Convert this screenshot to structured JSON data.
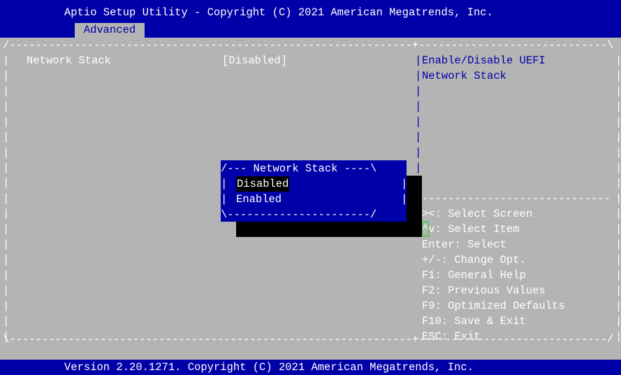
{
  "header": {
    "title": "Aptio Setup Utility - Copyright (C) 2021 American Megatrends, Inc.",
    "tab": "Advanced"
  },
  "setting": {
    "label": "Network Stack",
    "value": "[Disabled]"
  },
  "help_text": [
    "Enable/Disable UEFI",
    "Network Stack"
  ],
  "key_help": [
    "><: Select Screen",
    "^v: Select Item",
    "Enter: Select",
    "+/-: Change Opt.",
    "F1: General Help",
    "F2: Previous Values",
    "F9: Optimized Defaults",
    "F10: Save & Exit",
    "ESC: Exit"
  ],
  "popup": {
    "title": " Network Stack ",
    "options": [
      "Disabled",
      "Enabled"
    ],
    "selected": "Disabled"
  },
  "footer": {
    "version": "Version 2.20.1271. Copyright (C) 2021 American Megatrends, Inc."
  },
  "colors": {
    "bios_blue": "#0000a8",
    "panel_gray": "#b4b4b4",
    "highlight": "#000000",
    "cursor_green": "#22cc22"
  }
}
